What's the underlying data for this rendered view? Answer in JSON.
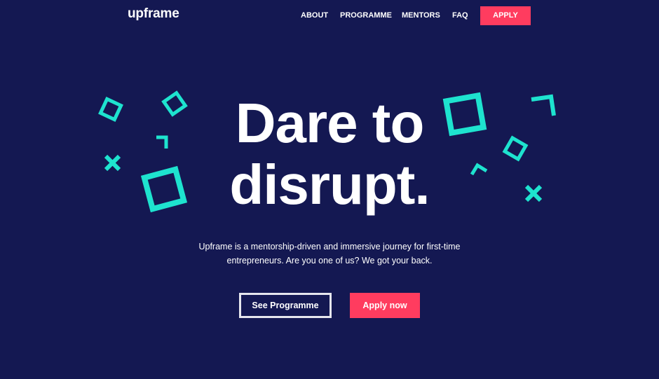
{
  "brand": {
    "logo": "upframe"
  },
  "nav": {
    "items": [
      {
        "label": "ABOUT"
      },
      {
        "label": "PROGRAMME"
      },
      {
        "label": "MENTORS"
      },
      {
        "label": "FAQ"
      }
    ],
    "apply_label": "APPLY"
  },
  "hero": {
    "title_line1": "Dare to",
    "title_line2": "disrupt.",
    "subtitle": "Upframe is a mentorship-driven and immersive journey for first-time entrepreneurs. Are you one of us? We got your back."
  },
  "cta": {
    "secondary_label": "See Programme",
    "primary_label": "Apply now"
  },
  "colors": {
    "background": "#141852",
    "accent": "#ff3c5f",
    "decor": "#1ee3cf",
    "text": "#ffffff"
  },
  "icons": [
    "square-outline-icon",
    "corner-bracket-icon",
    "cross-icon"
  ]
}
